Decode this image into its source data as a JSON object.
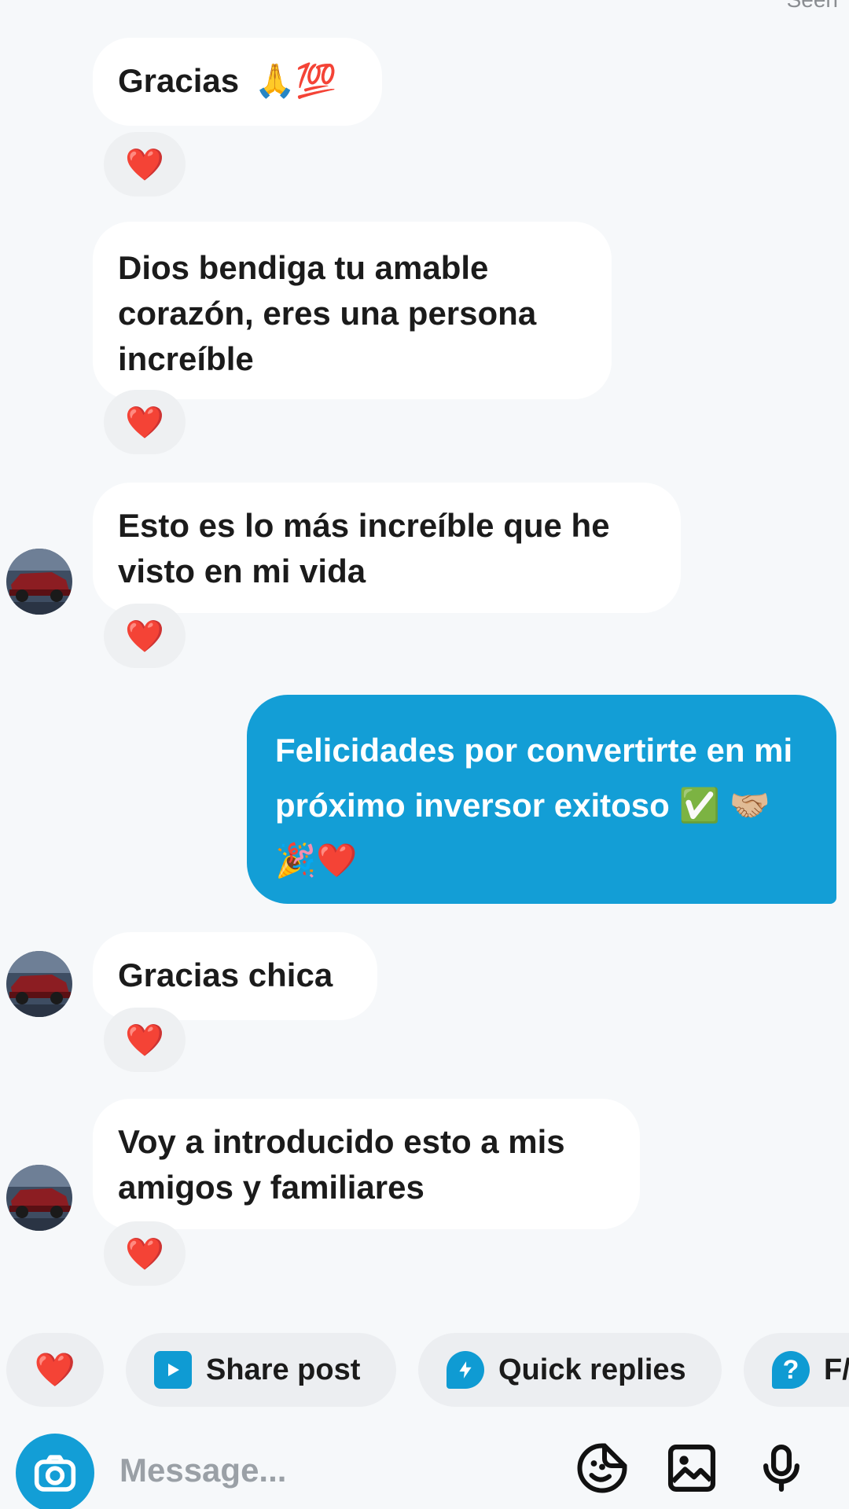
{
  "header": {
    "seen_label": "Seen"
  },
  "messages": [
    {
      "text": "Gracias",
      "emoji": "🙏💯",
      "reaction": "❤️"
    },
    {
      "text": "Dios bendiga tu amable corazón, eres una persona increíble",
      "reaction": "❤️"
    },
    {
      "text": "Esto es lo más increíble que he visto en mi vida",
      "reaction": "❤️"
    },
    {
      "text": "Felicidades por convertirte en mi próximo inversor exitoso ✅ 🤝🏼🎉❤️"
    },
    {
      "text": "Gracias chica",
      "reaction": "❤️"
    },
    {
      "text": "Voy a introducido esto a mis amigos y familiares",
      "reaction": "❤️"
    }
  ],
  "quick_bar": {
    "like_emoji": "❤️",
    "share_post_label": "Share post",
    "quick_replies_label": "Quick replies",
    "faq_icon": "?",
    "faq_label": "F/"
  },
  "composer": {
    "placeholder": "Message..."
  },
  "colors": {
    "accent": "#139ed6",
    "background": "#f6f8fa",
    "bubble_in": "#ffffff",
    "reaction_bg": "#eef0f2"
  }
}
